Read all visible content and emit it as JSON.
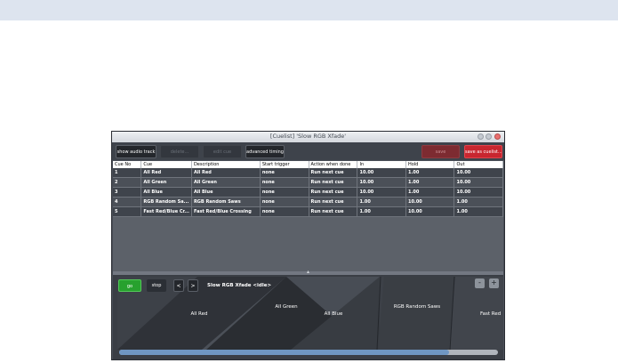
{
  "window": {
    "title": "[Cuelist] 'Slow RGB Xfade'"
  },
  "toolbar": {
    "show_audio_track": "show audio track",
    "delete": "delete...",
    "edit_cue": "edit cue",
    "advanced_timings": "advanced timings",
    "save": "save",
    "save_as_cuelist": "save as cuelist..."
  },
  "table": {
    "columns": [
      "Cue No",
      "Cue",
      "Description",
      "Start trigger",
      "Action when done",
      "In",
      "Hold",
      "Out"
    ],
    "rows": [
      [
        "1",
        "All Red",
        "All Red",
        "none",
        "Run next cue",
        "10.00",
        "1.00",
        "10.00"
      ],
      [
        "2",
        "All Green",
        "All Green",
        "none",
        "Run next cue",
        "10.00",
        "1.00",
        "10.00"
      ],
      [
        "3",
        "All Blue",
        "All Blue",
        "none",
        "Run next cue",
        "10.00",
        "1.00",
        "10.00"
      ],
      [
        "4",
        "RGB Random Sa...",
        "RGB Random Saws",
        "none",
        "Run next cue",
        "1.00",
        "10.00",
        "1.00"
      ],
      [
        "5",
        "Fast Red/Blue Cr...",
        "Fast Red/Blue Crossing",
        "none",
        "Run next cue",
        "1.00",
        "10.00",
        "1.00"
      ]
    ]
  },
  "divider": {
    "glyph": "▴"
  },
  "player": {
    "go": "go",
    "stop": "stop",
    "prev": "<",
    "next": ">",
    "status": "Slow RGB Xfade <idle>",
    "zoom_out": "-",
    "zoom_in": "+",
    "scroll_fraction": 0.87
  },
  "timeline": {
    "labels": [
      "All Red",
      "All Green",
      "All Blue",
      "RGB Random Saws",
      "Fast Red"
    ]
  }
}
